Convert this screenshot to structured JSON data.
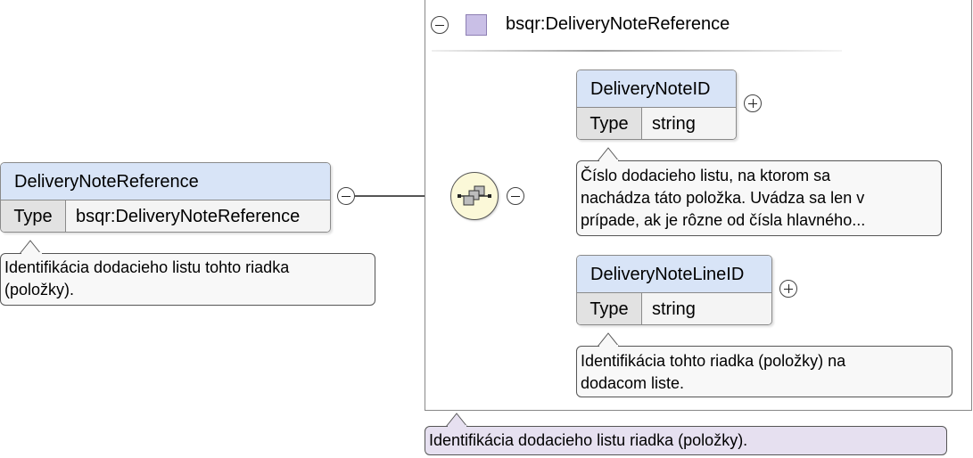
{
  "colors": {
    "element_header": "#d8e4f7",
    "type_key_bg": "#e2e2e2",
    "annotation_bg": "#f8f8f8",
    "group_annotation_bg": "#e6e0f0",
    "type_icon": "#c9bfe6",
    "compositor_bg": "#fbf8d8"
  },
  "root": {
    "name": "DeliveryNoteReference",
    "type_label": "Type",
    "type_value": "bsqr:DeliveryNoteReference",
    "annotation": "Identifikácia dodacieho listu tohto riadka\n(položky).",
    "toggle_icon": "minus-icon"
  },
  "complex_type": {
    "title": "bsqr:DeliveryNoteReference",
    "collapse_icon": "minus-icon",
    "type_icon": "complex-type-icon",
    "annotation": "Identifikácia dodacieho listu riadka (položky)."
  },
  "sequence": {
    "icon": "sequence-compositor-icon",
    "toggle_icon": "minus-icon"
  },
  "children": [
    {
      "name": "DeliveryNoteID",
      "type_label": "Type",
      "type_value": "string",
      "expand_icon": "plus-icon",
      "annotation": "Číslo dodacieho listu, na ktorom sa\nnachádza táto položka. Uvádza sa len v\nprípade, ak je rôzne od čísla hlavného..."
    },
    {
      "name": "DeliveryNoteLineID",
      "type_label": "Type",
      "type_value": "string",
      "expand_icon": "plus-icon",
      "annotation": "Identifikácia tohto riadka (položky) na\ndodacom liste."
    }
  ]
}
